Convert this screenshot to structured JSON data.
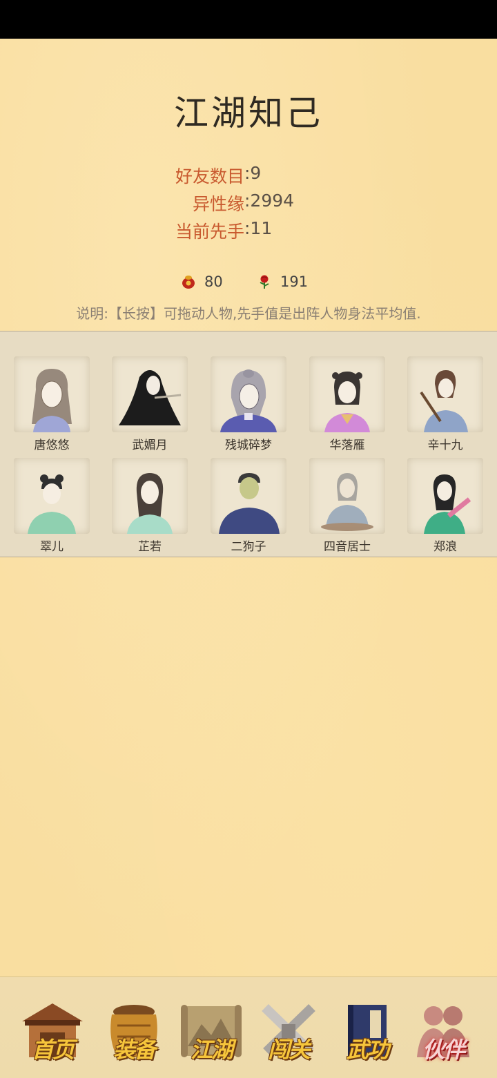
{
  "page_title": "江湖知己",
  "stats": [
    {
      "label": "好友数目",
      "value": ":9"
    },
    {
      "label": "异性缘",
      "value": ":2994"
    },
    {
      "label": "当前先手",
      "value": ":11"
    }
  ],
  "currency": {
    "pouch_icon": "red-pouch-icon",
    "pouch_value": "80",
    "rose_icon": "rose-icon",
    "rose_value": "191"
  },
  "note": "说明:【长按】可拖动人物,先手值是出阵人物身法平均值.",
  "companions": [
    {
      "name": "唐悠悠"
    },
    {
      "name": "武媚月"
    },
    {
      "name": "残城碎梦"
    },
    {
      "name": "华落雁"
    },
    {
      "name": "辛十九"
    },
    {
      "name": "翠儿"
    },
    {
      "name": "芷若"
    },
    {
      "name": "二狗子"
    },
    {
      "name": "四音居士"
    },
    {
      "name": "郑浪"
    }
  ],
  "nav": [
    {
      "label": "首页",
      "icon": "house-icon"
    },
    {
      "label": "装备",
      "icon": "armor-icon"
    },
    {
      "label": "江湖",
      "icon": "scroll-map-icon"
    },
    {
      "label": "闯关",
      "icon": "crossed-swords-icon"
    },
    {
      "label": "武功",
      "icon": "martial-book-icon"
    },
    {
      "label": "伙伴",
      "icon": "companions-icon",
      "active": true
    }
  ],
  "colors": {
    "background": "#f9dea0",
    "stat_label": "#c8592e",
    "panel": "#e7dcc3",
    "nav_text": "#f6c53b"
  }
}
